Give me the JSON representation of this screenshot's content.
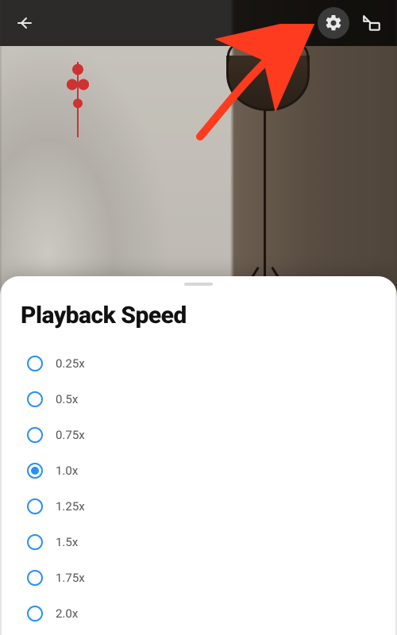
{
  "colors": {
    "accent": "#2a8ff4",
    "arrow": "#ff3b1f"
  },
  "topbar": {
    "back_icon": "arrow-left",
    "settings_icon": "gear",
    "pip_icon": "picture-in-picture"
  },
  "sheet": {
    "title": "Playback Speed",
    "options": [
      {
        "label": "0.25x",
        "selected": false
      },
      {
        "label": "0.5x",
        "selected": false
      },
      {
        "label": "0.75x",
        "selected": false
      },
      {
        "label": "1.0x",
        "selected": true
      },
      {
        "label": "1.25x",
        "selected": false
      },
      {
        "label": "1.5x",
        "selected": false
      },
      {
        "label": "1.75x",
        "selected": false
      },
      {
        "label": "2.0x",
        "selected": false
      }
    ]
  },
  "annotation": {
    "target": "settings-button"
  }
}
